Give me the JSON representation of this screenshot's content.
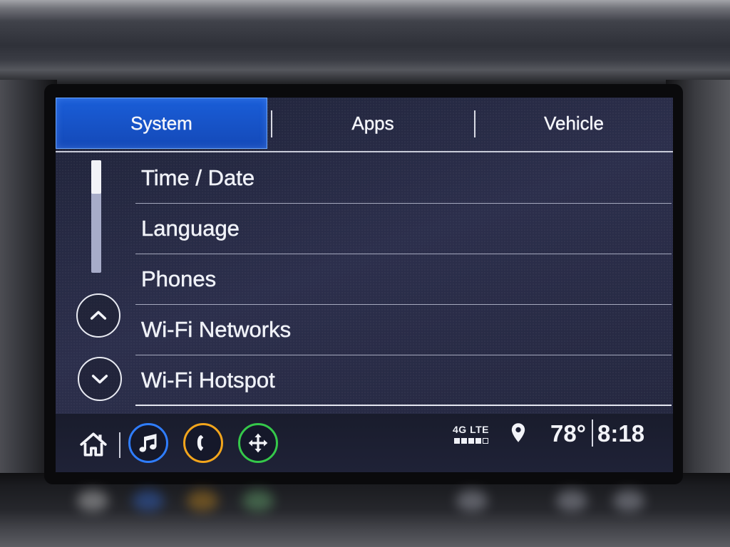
{
  "tabs": [
    {
      "label": "System",
      "selected": true
    },
    {
      "label": "Apps",
      "selected": false
    },
    {
      "label": "Vehicle",
      "selected": false
    }
  ],
  "menu": {
    "items": [
      {
        "label": "Time / Date"
      },
      {
        "label": "Language"
      },
      {
        "label": "Phones"
      },
      {
        "label": "Wi-Fi Networks"
      },
      {
        "label": "Wi-Fi Hotspot"
      }
    ],
    "scroll_up_icon": "chevron-up-icon",
    "scroll_down_icon": "chevron-down-icon"
  },
  "dock": {
    "home_icon": "home-icon",
    "shortcuts": [
      {
        "icon": "music-note-icon",
        "ring_color": "#2f7dff"
      },
      {
        "icon": "phone-icon",
        "ring_color": "#f2a51c"
      },
      {
        "icon": "navigation-icon",
        "ring_color": "#35c84a"
      }
    ]
  },
  "status": {
    "network": "4G LTE",
    "signal": {
      "bars": 4,
      "max": 5
    },
    "location_icon": "location-pin-icon",
    "temperature": "78°",
    "time": "8:18"
  },
  "colors": {
    "selected_tab": "#1a5ed8",
    "selected_tab_dark": "#1449b8",
    "screen_background": "#23263d",
    "text": "#eef0f6"
  }
}
